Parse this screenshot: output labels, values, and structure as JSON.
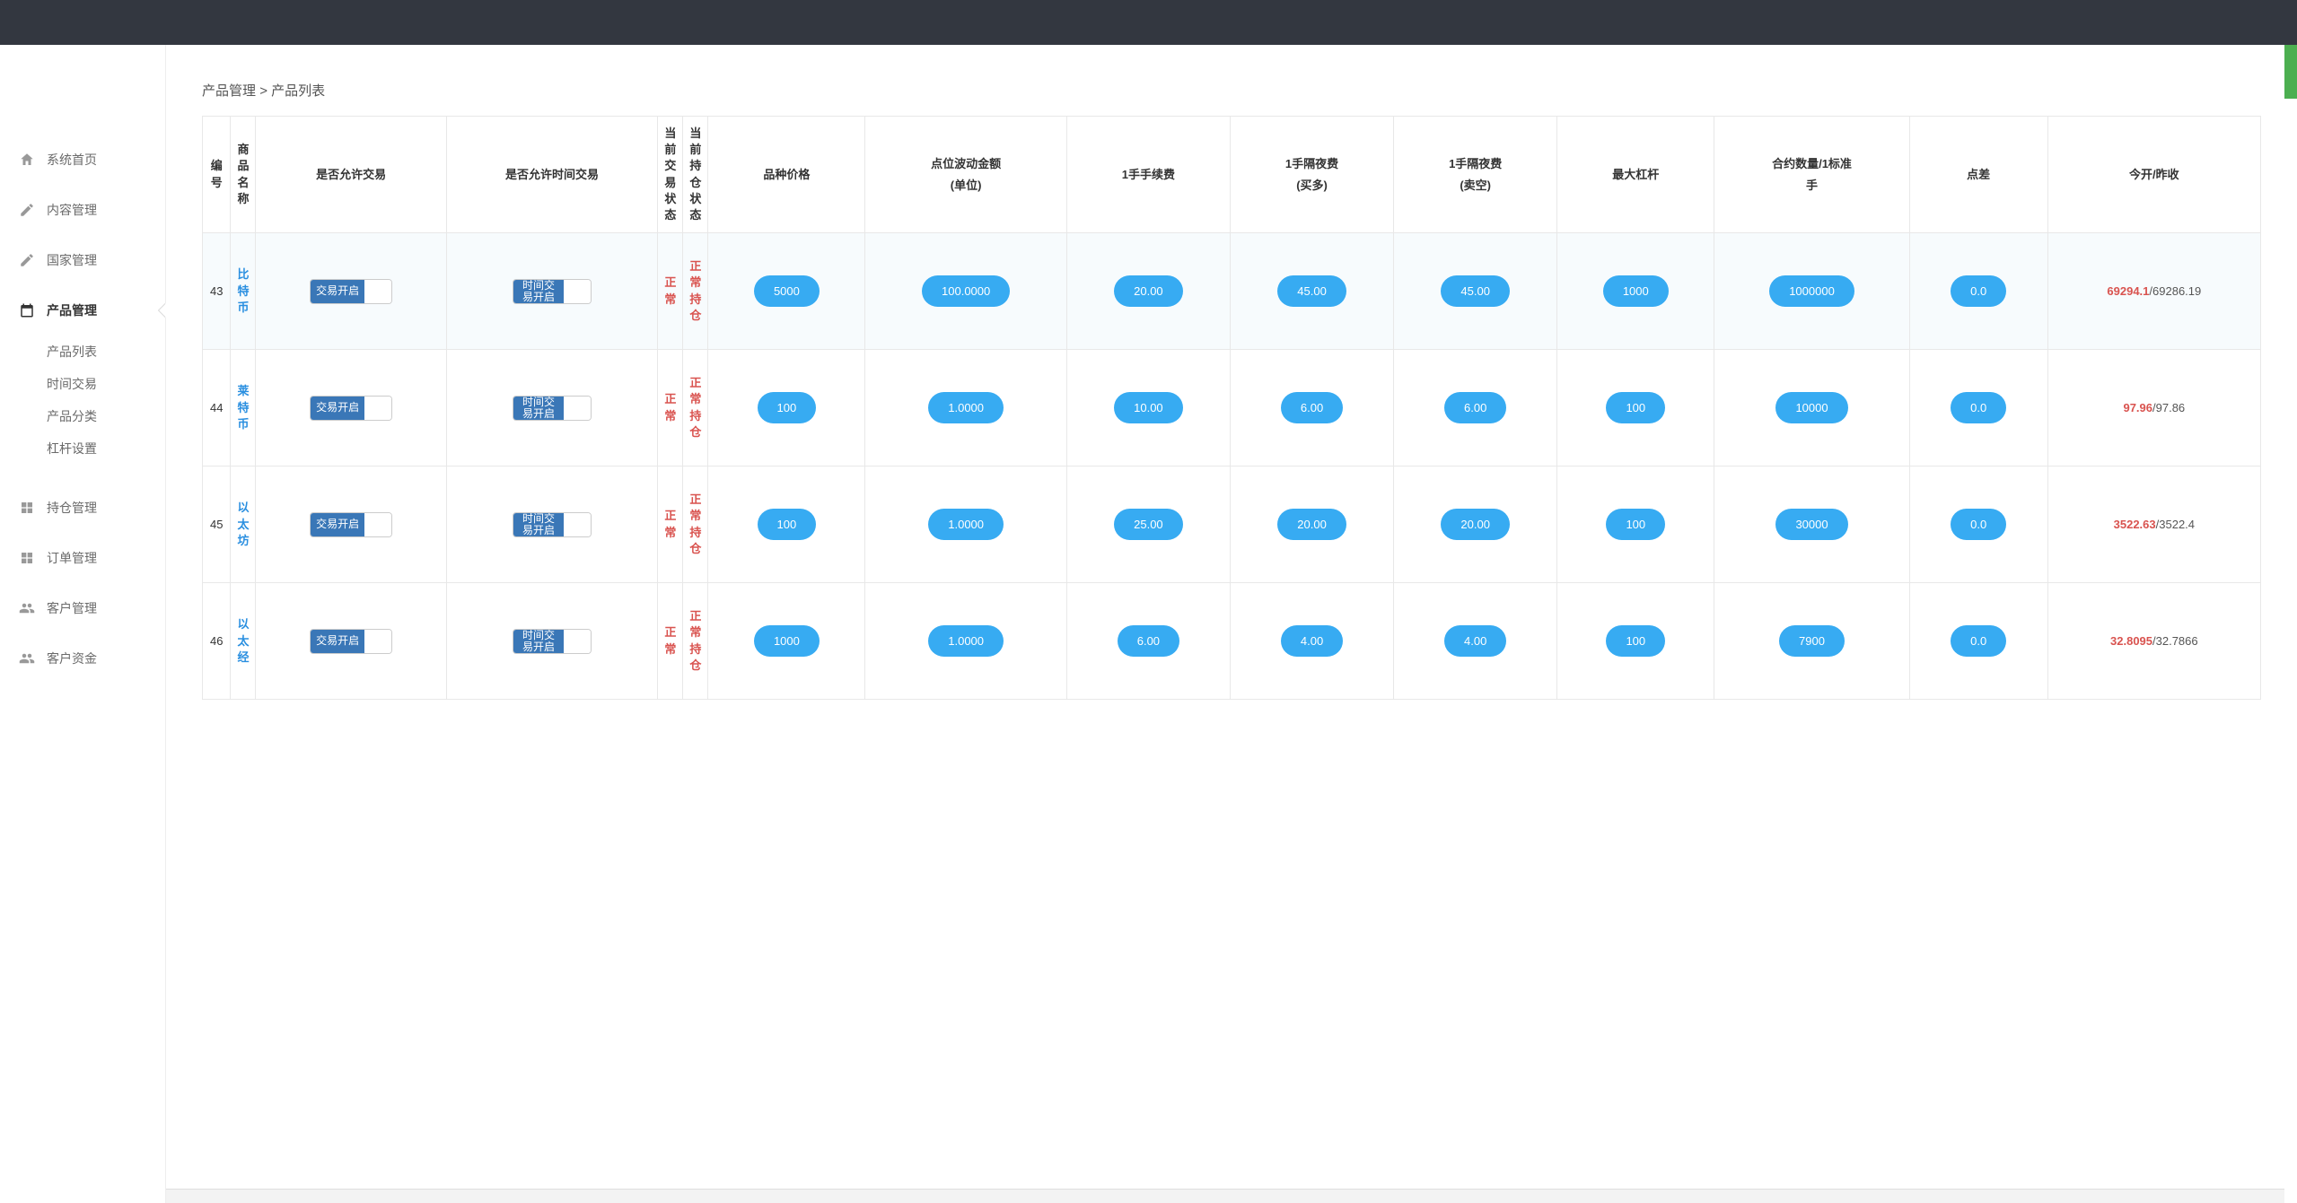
{
  "breadcrumb": {
    "parent": "产品管理",
    "sep": ">",
    "current": "产品列表"
  },
  "sidebar": {
    "items": [
      {
        "label": "系统首页"
      },
      {
        "label": "内容管理"
      },
      {
        "label": "国家管理"
      },
      {
        "label": "产品管理",
        "active": true,
        "subs": [
          "产品列表",
          "时间交易",
          "产品分类",
          "杠杆设置"
        ]
      },
      {
        "label": "持仓管理"
      },
      {
        "label": "订单管理"
      },
      {
        "label": "客户管理"
      },
      {
        "label": "客户资金"
      }
    ]
  },
  "table": {
    "headers": {
      "id": "编号",
      "name": "商品名称",
      "allow_trade": "是否允许交易",
      "allow_time": "是否允许时间交易",
      "trade_status": "当前交易状态",
      "hold_status": "当前持仓状态",
      "price": "品种价格",
      "point_amount": "点位波动金额(单位)",
      "fee": "1手手续费",
      "overnight_buy": "1手隔夜费(买多)",
      "overnight_sell": "1手隔夜费(卖空)",
      "max_leverage": "最大杠杆",
      "contract": "合约数量/1标准手",
      "spread": "点差",
      "open_close": "今开/昨收"
    },
    "toggle_labels": {
      "trade_on": "交易开启",
      "time_on": "时间交易开启"
    },
    "status_labels": {
      "normal": "正常",
      "normal_hold": "正常持仓"
    },
    "rows": [
      {
        "id": "43",
        "name": "比特币",
        "price": "5000",
        "point_amount": "100.0000",
        "fee": "20.00",
        "overnight_buy": "45.00",
        "overnight_sell": "45.00",
        "max_leverage": "1000",
        "contract": "1000000",
        "spread": "0.0",
        "open": "69294.1",
        "close": "69286.19"
      },
      {
        "id": "44",
        "name": "莱特币",
        "price": "100",
        "point_amount": "1.0000",
        "fee": "10.00",
        "overnight_buy": "6.00",
        "overnight_sell": "6.00",
        "max_leverage": "100",
        "contract": "10000",
        "spread": "0.0",
        "open": "97.96",
        "close": "97.86"
      },
      {
        "id": "45",
        "name": "以太坊",
        "price": "100",
        "point_amount": "1.0000",
        "fee": "25.00",
        "overnight_buy": "20.00",
        "overnight_sell": "20.00",
        "max_leverage": "100",
        "contract": "30000",
        "spread": "0.0",
        "open": "3522.63",
        "close": "3522.4"
      },
      {
        "id": "46",
        "name": "以太经",
        "price": "1000",
        "point_amount": "1.0000",
        "fee": "6.00",
        "overnight_buy": "4.00",
        "overnight_sell": "4.00",
        "max_leverage": "100",
        "contract": "7900",
        "spread": "0.0",
        "open": "32.8095",
        "close": "32.7866"
      }
    ]
  }
}
